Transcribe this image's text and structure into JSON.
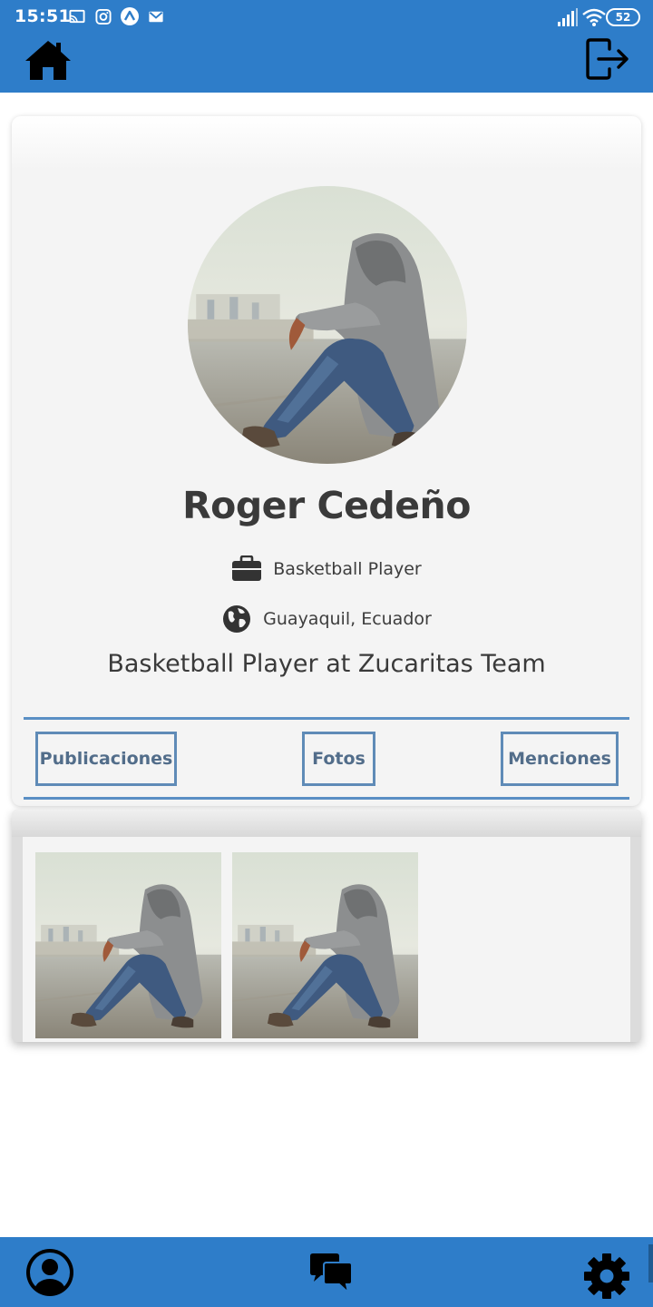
{
  "status_bar": {
    "time": "15:51",
    "battery": "52",
    "icons": [
      "cast-icon",
      "instagram-icon",
      "app-icon",
      "gmail-icon",
      "signal-icon",
      "wifi-icon",
      "battery-icon"
    ]
  },
  "header": {
    "home_icon": "home-icon",
    "logout_icon": "logout-icon"
  },
  "profile": {
    "name": "Roger Cedeño",
    "occupation": "Basketball Player",
    "location": "Guayaquil, Ecuador",
    "bio": "Basketball Player at Zucaritas Team"
  },
  "tabs": [
    {
      "label": "Publicaciones"
    },
    {
      "label": "Fotos"
    },
    {
      "label": "Menciones"
    }
  ],
  "gallery": {
    "photo_count": 2
  },
  "bottom_nav": {
    "items": [
      "profile-icon",
      "chat-icon",
      "settings-icon"
    ]
  },
  "colors": {
    "primary": "#2e7dc9",
    "tab_border": "#5f8bb7",
    "tab_text": "#526d8a",
    "card_bg": "#f4f4f4"
  }
}
